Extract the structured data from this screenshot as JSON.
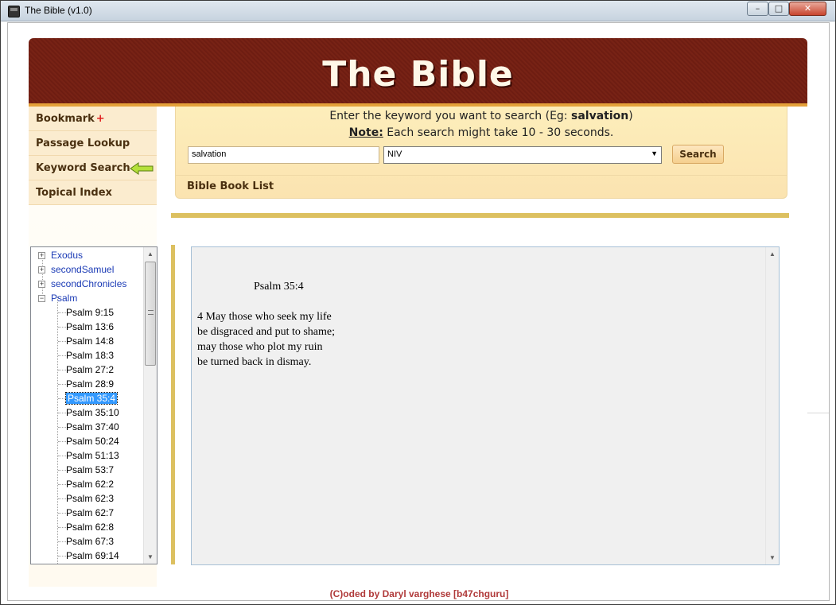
{
  "window": {
    "title": "The Bible (v1.0)",
    "controls": {
      "minimize": "–",
      "maximize": "□",
      "close": "✕"
    }
  },
  "banner": {
    "title": "The Bible"
  },
  "nav": {
    "items": [
      {
        "label": "Bookmark",
        "suffix": "+"
      },
      {
        "label": "Passage Lookup"
      },
      {
        "label": "Keyword Search",
        "active": true
      },
      {
        "label": "Topical Index"
      }
    ]
  },
  "search": {
    "hint_prefix": "Enter the keyword you want to search (Eg: ",
    "hint_example": "salvation",
    "hint_suffix": ")",
    "note_label": "Note:",
    "note_text": " Each search might take 10 - 30 seconds.",
    "keyword_value": "salvation",
    "version_value": "NIV",
    "button_label": "Search",
    "book_list_label": "Bible Book List"
  },
  "tree": {
    "parents": [
      "Exodus",
      "secondSamuel",
      "secondChronicles",
      "Psalm"
    ],
    "expanded_parent": "Psalm",
    "children": [
      "Psalm 9:15",
      "Psalm 13:6",
      "Psalm 14:8",
      "Psalm 18:3",
      "Psalm 27:2",
      "Psalm 28:9",
      "Psalm 35:4",
      "Psalm 35:10",
      "Psalm 37:40",
      "Psalm 50:24",
      "Psalm 51:13",
      "Psalm 53:7",
      "Psalm 62:2",
      "Psalm 62:3",
      "Psalm 62:7",
      "Psalm 62:8",
      "Psalm 67:3",
      "Psalm 69:14"
    ],
    "selected": "Psalm 35:4"
  },
  "content": {
    "reference": "Psalm 35:4",
    "lines": [
      "4 May those who seek my life",
      "be disgraced and put to shame;",
      "may those who plot my ruin",
      "be turned back in dismay."
    ]
  },
  "footer": {
    "credit": "(C)oded by Daryl varghese [b47chguru]"
  },
  "colors": {
    "banner": "#6e1d12",
    "nav_bg": "#fbeccf",
    "panel_bg": "#fde9b5",
    "gold_rule": "#dcc060",
    "selection": "#3399ff",
    "footer_text": "#b03a3a"
  }
}
